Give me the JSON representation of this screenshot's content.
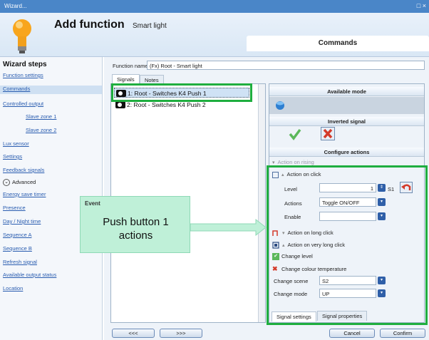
{
  "window": {
    "title": "Wizard...",
    "controls": "□ ×"
  },
  "header": {
    "title": "Add function",
    "subtitle": "Smart light",
    "active_tab": "Commands"
  },
  "sidebar": {
    "heading": "Wizard steps",
    "items": [
      {
        "label": "Function settings"
      },
      {
        "label": "Commands"
      },
      {
        "label": "Controlled output"
      },
      {
        "label": "Slave zone 1"
      },
      {
        "label": "Slave zone 2"
      },
      {
        "label": "Lux sensor"
      },
      {
        "label": "Settings"
      },
      {
        "label": "Feedback signals"
      },
      {
        "label": "Advanced"
      },
      {
        "label": "Energy save timer"
      },
      {
        "label": "Presence"
      },
      {
        "label": "Day / Night time"
      },
      {
        "label": "Sequence A"
      },
      {
        "label": "Sequence B"
      },
      {
        "label": "Refresh signal"
      },
      {
        "label": "Available output status"
      },
      {
        "label": "Location"
      }
    ]
  },
  "function_name": {
    "label": "Function name:",
    "value": "(Fx) Root - Smart light"
  },
  "tabs": {
    "signals": "Signals",
    "notes": "Notes"
  },
  "signals": [
    {
      "label": "1: Root - Switches K4 Push 1"
    },
    {
      "label": "2: Root - Switches K4 Push 2"
    }
  ],
  "right": {
    "available_mode": "Available mode",
    "inverted_signal": "Inverted signal",
    "configure_actions": "Configure actions",
    "action_on_rising": "Action on rising",
    "action_on_click": "Action on click",
    "level_label": "Level",
    "level_value": "1",
    "level_unit": "S1",
    "actions_label": "Actions",
    "actions_value": "Toggle ON/OFF",
    "enable_label": "Enable",
    "enable_value": "",
    "action_on_long_click": "Action on long click",
    "action_on_very_long_click": "Action on very long click",
    "change_level": "Change level",
    "change_colour_temperature": "Change colour temperature",
    "change_scene_label": "Change scene",
    "change_scene_value": "S2",
    "change_mode_label": "Change mode",
    "change_mode_value": "UP",
    "tab_signal_settings": "Signal settings",
    "tab_signal_properties": "Signal properties"
  },
  "callout": {
    "tag": "Event",
    "line1": "Push button 1",
    "line2": "actions"
  },
  "footer": {
    "prev": "<<<",
    "next": ">>>",
    "cancel": "Cancel",
    "confirm": "Confirm"
  },
  "colors": {
    "highlight_green": "#1fae3f",
    "title_blue": "#4a86c8",
    "callout": "#bff0d8"
  }
}
